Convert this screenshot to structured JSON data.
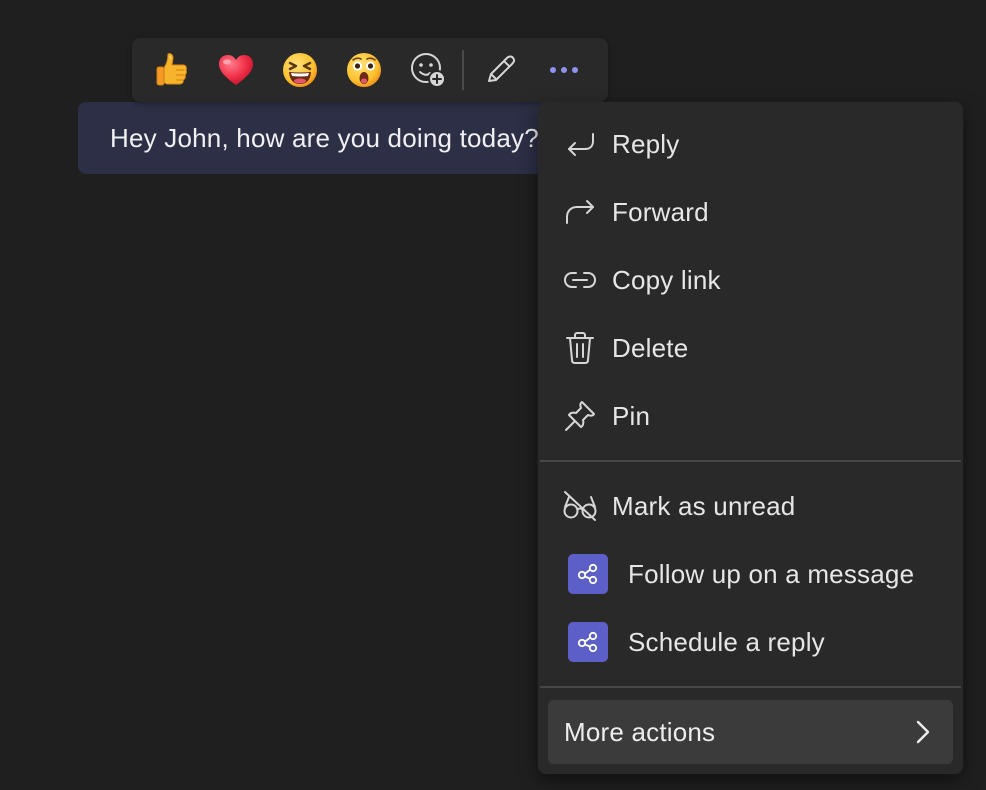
{
  "message": {
    "text": "Hey John, how are you doing today?"
  },
  "reactions": [
    {
      "name": "like",
      "icon": "thumbs-up-icon"
    },
    {
      "name": "heart",
      "icon": "heart-icon"
    },
    {
      "name": "laugh",
      "icon": "laughing-face-icon"
    },
    {
      "name": "surprised",
      "icon": "surprised-face-icon"
    },
    {
      "name": "more-reactions",
      "icon": "add-reaction-icon"
    }
  ],
  "toolbar": {
    "edit_icon": "pencil-icon",
    "more_icon": "more-options-icon"
  },
  "menu": {
    "items": [
      {
        "label": "Reply",
        "icon": "reply-arrow-icon"
      },
      {
        "label": "Forward",
        "icon": "forward-arrow-icon"
      },
      {
        "label": "Copy link",
        "icon": "link-icon"
      },
      {
        "label": "Delete",
        "icon": "trash-icon"
      },
      {
        "label": "Pin",
        "icon": "pin-icon"
      }
    ],
    "secondary": [
      {
        "label": "Mark as unread",
        "icon": "glasses-off-icon"
      }
    ],
    "apps": [
      {
        "label": "Follow up on a message",
        "icon": "share-nodes-icon"
      },
      {
        "label": "Schedule a reply",
        "icon": "share-nodes-icon"
      }
    ],
    "more_actions": {
      "label": "More actions",
      "icon": "chevron-right-icon"
    }
  },
  "colors": {
    "background": "#1f1f1f",
    "menu_bg": "#292929",
    "bubble_bg": "#2c2f46",
    "accent": "#5b5fc7",
    "more_dots": "#8f93f0"
  }
}
